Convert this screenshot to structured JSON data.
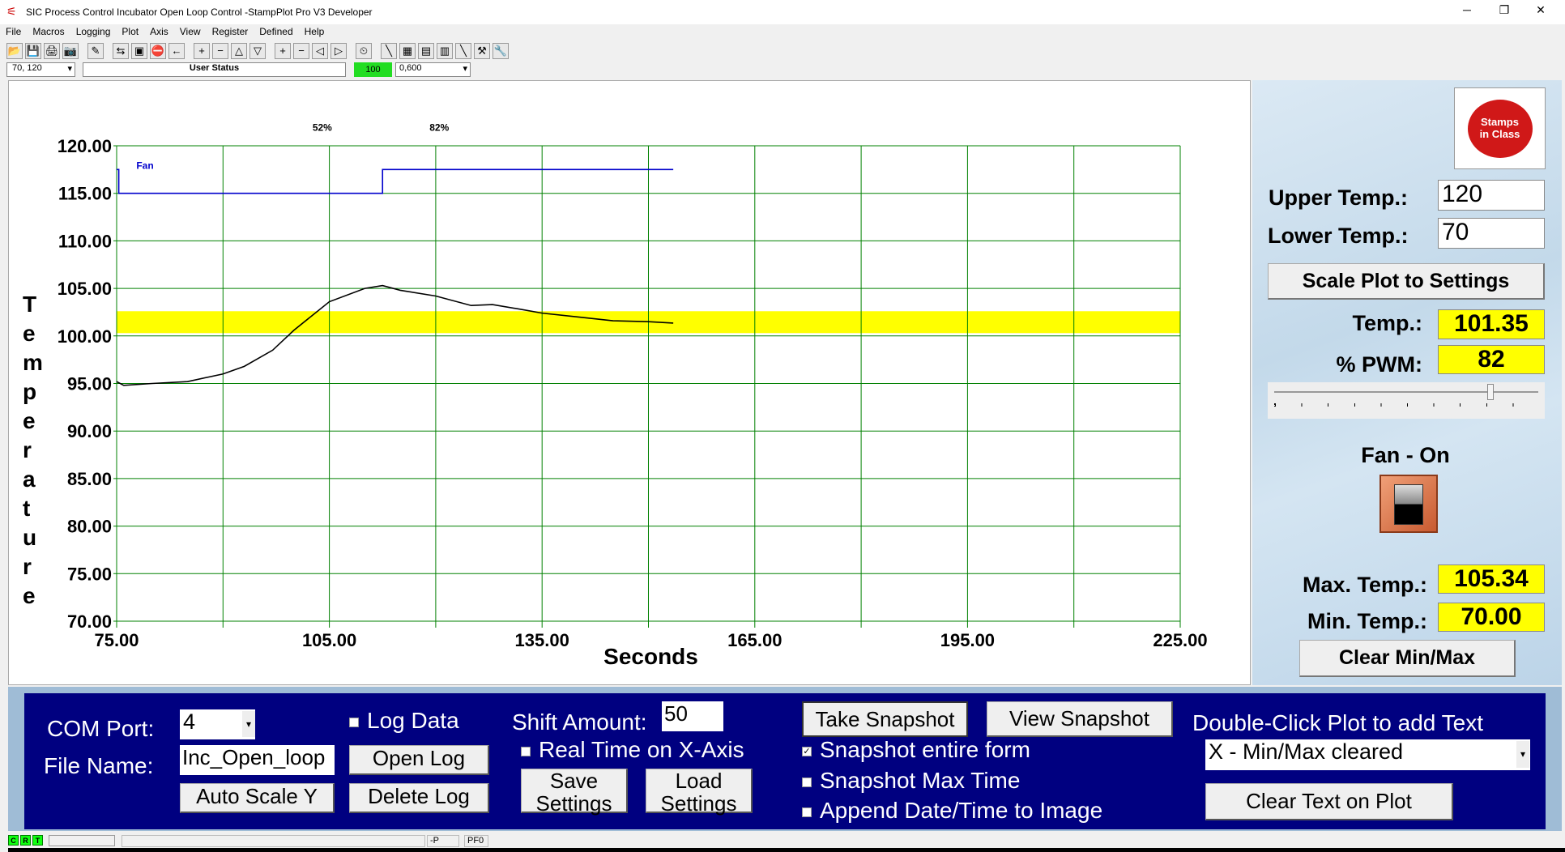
{
  "window": {
    "title": "SIC Process Control Incubator Open Loop Control -StampPlot Pro V3 Developer",
    "minimize": "─",
    "maximize": "❐",
    "close": "✕"
  },
  "menu": [
    "File",
    "Macros",
    "Logging",
    "Plot",
    "Axis",
    "View",
    "Register",
    "Defined",
    "Help"
  ],
  "toolbar": {
    "icons": [
      "open-icon",
      "save-icon",
      "print-icon",
      "camera-icon",
      "wand-icon",
      "connect-icon",
      "monitor-icon",
      "stop-icon",
      "arrow-left-icon",
      "plus-icon",
      "minus-icon",
      "up-icon",
      "down-icon",
      "plus-icon",
      "minus-icon",
      "left-icon",
      "right-icon",
      "clock-icon",
      "pen-icon",
      "chart-icon",
      "notes-icon",
      "calculator-icon",
      "probe-icon",
      "tools-icon",
      "wrench-icon"
    ],
    "glyphs": [
      "📂",
      "💾",
      "🖨",
      "📷",
      "✎",
      "⇆",
      "▣",
      "⛔",
      "←",
      "+",
      "−",
      "△",
      "▽",
      "+",
      "−",
      "◁",
      "▷",
      "⏲",
      "╲",
      "▦",
      "▤",
      "▥",
      "╲",
      "⚒",
      "🔧"
    ],
    "y_range": "70, 120",
    "user_status": "User Status",
    "rate": "100",
    "x_range": "0,600"
  },
  "chart_data": {
    "type": "line",
    "title": "",
    "xlabel": "Seconds",
    "ylabel": "Temperature",
    "xlim": [
      75,
      225
    ],
    "ylim": [
      70,
      120
    ],
    "x_ticks": [
      "75.00",
      "105.00",
      "135.00",
      "165.00",
      "195.00",
      "225.00"
    ],
    "y_ticks": [
      "70.00",
      "75.00",
      "80.00",
      "85.00",
      "90.00",
      "95.00",
      "100.00",
      "105.00",
      "110.00",
      "115.00",
      "120.00"
    ],
    "grid": true,
    "grid_color": "#008000",
    "band": {
      "from": 100.3,
      "to": 102.6,
      "color": "#ffff00"
    },
    "annotations": [
      {
        "text": "52%",
        "x": 104,
        "y": 122
      },
      {
        "text": "82%",
        "x": 120.5,
        "y": 122
      },
      {
        "text": "Fan",
        "x": 79,
        "y": 118
      }
    ],
    "series": [
      {
        "color": "#000000",
        "points": [
          [
            75,
            95.2
          ],
          [
            76,
            94.8
          ],
          [
            80,
            95
          ],
          [
            85,
            95.2
          ],
          [
            90,
            96
          ],
          [
            93,
            96.8
          ],
          [
            97,
            98.5
          ],
          [
            100,
            100.6
          ],
          [
            105,
            103.6
          ],
          [
            110,
            105
          ],
          [
            112.5,
            105.3
          ],
          [
            115,
            104.8
          ],
          [
            120,
            104.2
          ],
          [
            125,
            103.2
          ],
          [
            128,
            103.3
          ],
          [
            132,
            102.8
          ],
          [
            135,
            102.4
          ],
          [
            140,
            102
          ],
          [
            145,
            101.6
          ],
          [
            150,
            101.5
          ],
          [
            153.5,
            101.35
          ]
        ]
      },
      {
        "name": "Fan",
        "color": "#0000cc",
        "points": [
          [
            75,
            117.5
          ],
          [
            75.3,
            117.5
          ],
          [
            75.3,
            115
          ],
          [
            112.5,
            115
          ],
          [
            112.5,
            117.5
          ],
          [
            153.5,
            117.5
          ]
        ]
      }
    ]
  },
  "panel": {
    "upper_label": "Upper Temp.:",
    "upper_value": "120",
    "lower_label": "Lower Temp.:",
    "lower_value": "70",
    "scale_button": "Scale Plot to Settings",
    "temp_label": "Temp.:",
    "temp_value": "101.35",
    "pwm_label": "% PWM:",
    "pwm_value": "82",
    "pwm_slider": 82,
    "fan_label": "Fan - On",
    "fan_on": true,
    "max_label": "Max. Temp.:",
    "max_value": "105.34",
    "min_label": "Min. Temp.:",
    "min_value": "70.00",
    "clear_minmax": "Clear Min/Max",
    "logo": "www.Stamps in Class .com"
  },
  "controls": {
    "com_label": "COM Port:",
    "com_value": "4",
    "file_label": "File Name:",
    "file_value": "Inc_Open_loop",
    "auto_scale": "Auto Scale Y",
    "log_data": "Log Data",
    "open_log": "Open Log",
    "delete_log": "Delete Log",
    "shift_label": "Shift Amount:",
    "shift_value": "50",
    "real_time": "Real Time on X-Axis",
    "save_settings": "Save Settings",
    "load_settings": "Load Settings",
    "take_snapshot": "Take Snapshot",
    "view_snapshot": "View Snapshot",
    "snap_entire": "Snapshot entire form",
    "snap_max": "Snapshot Max Time",
    "append_date": "Append Date/Time to Image",
    "dbl_click": "Double-Click Plot to add Text",
    "text_select": "X - Min/Max cleared",
    "clear_text": "Clear Text on Plot"
  },
  "status": {
    "c": "C",
    "r": "R",
    "t": "T",
    "p": "-P",
    "pf": "PF0"
  }
}
